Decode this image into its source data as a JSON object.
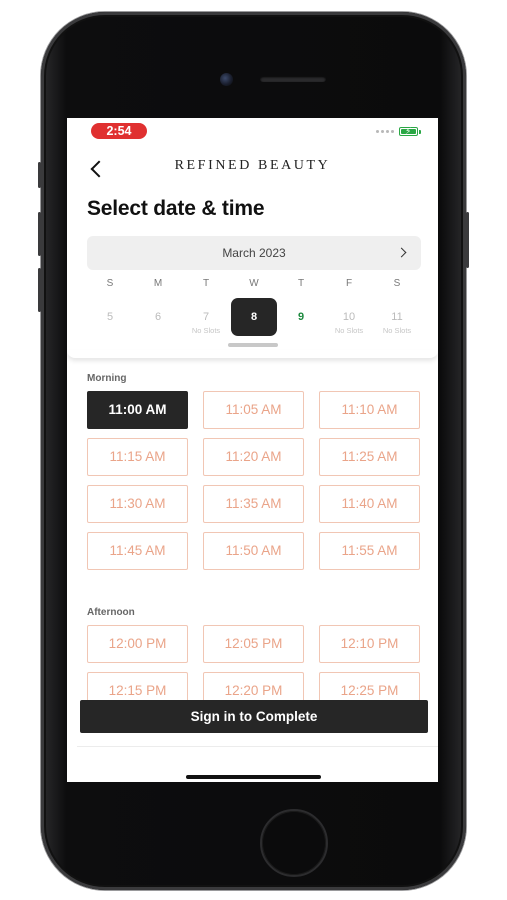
{
  "status_bar": {
    "time": "2:54"
  },
  "header": {
    "brand": "REFINED BEAUTY",
    "title": "Select date & time"
  },
  "calendar": {
    "month": "March 2023",
    "weekday_letters": [
      "S",
      "M",
      "T",
      "W",
      "T",
      "F",
      "S"
    ],
    "days": [
      {
        "num": "5",
        "note": "",
        "state": "unavailable"
      },
      {
        "num": "6",
        "note": "",
        "state": "unavailable"
      },
      {
        "num": "7",
        "note": "No Slots",
        "state": "unavailable"
      },
      {
        "num": "8",
        "note": "",
        "state": "selected"
      },
      {
        "num": "9",
        "note": "",
        "state": "available"
      },
      {
        "num": "10",
        "note": "No Slots",
        "state": "unavailable"
      },
      {
        "num": "11",
        "note": "No Slots",
        "state": "unavailable"
      }
    ]
  },
  "morning": {
    "label": "Morning",
    "slots": [
      "11:00 AM",
      "11:05 AM",
      "11:10 AM",
      "11:15 AM",
      "11:20 AM",
      "11:25 AM",
      "11:30 AM",
      "11:35 AM",
      "11:40 AM",
      "11:45 AM",
      "11:50 AM",
      "11:55 AM"
    ],
    "selected": "11:00 AM"
  },
  "afternoon": {
    "label": "Afternoon",
    "slots": [
      "12:00 PM",
      "12:05 PM",
      "12:10 PM",
      "12:15 PM",
      "12:20 PM",
      "12:25 PM"
    ]
  },
  "cta": {
    "label": "Sign in to Complete"
  },
  "colors": {
    "selected": "#262626",
    "slot_border": "#f1c6b4",
    "slot_text": "#eaa489",
    "available_day": "#1e8a3f",
    "status_time_pill": "#e03030"
  }
}
